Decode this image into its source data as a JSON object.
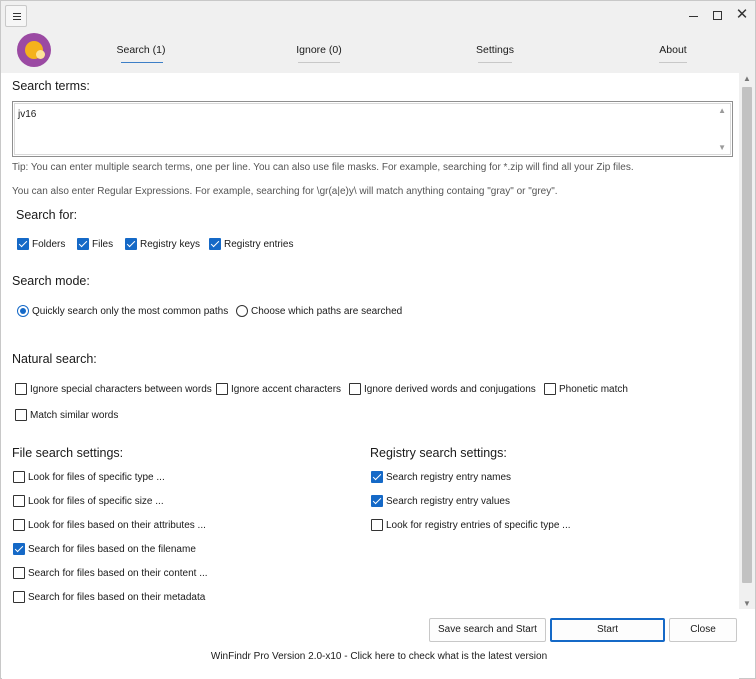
{
  "window": {
    "close_glyph": "✕"
  },
  "tabs": [
    {
      "label": "Search (1)"
    },
    {
      "label": "Ignore (0)"
    },
    {
      "label": "Settings"
    },
    {
      "label": "About"
    }
  ],
  "search": {
    "terms_label": "Search terms:",
    "terms_value": "jv16",
    "tip1": "Tip: You can enter multiple search terms, one per line. You can also use file masks. For example, searching for *.zip will find all your Zip files.",
    "tip2": "You can also enter Regular Expressions. For example, searching for \\gr(a|e)y\\ will match anything containg \"gray\" or \"grey\"."
  },
  "search_for": {
    "label": "Search for:",
    "options": [
      {
        "label": "Folders",
        "checked": true
      },
      {
        "label": "Files",
        "checked": true
      },
      {
        "label": "Registry keys",
        "checked": true
      },
      {
        "label": "Registry entries",
        "checked": true
      }
    ]
  },
  "search_mode": {
    "label": "Search mode:",
    "options": [
      {
        "label": "Quickly search only the most common paths",
        "checked": true
      },
      {
        "label": "Choose which paths are searched",
        "checked": false
      }
    ]
  },
  "natural_search": {
    "label": "Natural search:",
    "options": [
      {
        "label": "Ignore special characters between words",
        "checked": false
      },
      {
        "label": "Ignore accent characters",
        "checked": false
      },
      {
        "label": "Ignore derived words and conjugations",
        "checked": false
      },
      {
        "label": "Phonetic match",
        "checked": false
      },
      {
        "label": "Match similar words",
        "checked": false
      }
    ]
  },
  "file_settings": {
    "label": "File search settings:",
    "options": [
      {
        "label": "Look for files of specific type ...",
        "checked": false
      },
      {
        "label": "Look for files of specific size ...",
        "checked": false
      },
      {
        "label": "Look for files based on their attributes ...",
        "checked": false
      },
      {
        "label": "Search for files based on the filename",
        "checked": true
      },
      {
        "label": "Search for files based on their content ...",
        "checked": false
      },
      {
        "label": "Search for files based on their metadata",
        "checked": false
      }
    ]
  },
  "registry_settings": {
    "label": "Registry search settings:",
    "options": [
      {
        "label": "Search registry entry names",
        "checked": true
      },
      {
        "label": "Search registry entry values",
        "checked": true
      },
      {
        "label": "Look for registry entries of specific type ...",
        "checked": false
      }
    ]
  },
  "buttons": {
    "save_and_start": "Save search and Start",
    "start": "Start",
    "close": "Close"
  },
  "footer": "WinFindr Pro Version 2.0-x10 - Click here to check what is the latest version",
  "colors": {
    "accent": "#1569c7",
    "logo_purple": "#9b4aa3",
    "logo_yellow": "#f5b21c",
    "titlebar": "#f0f0f0"
  }
}
